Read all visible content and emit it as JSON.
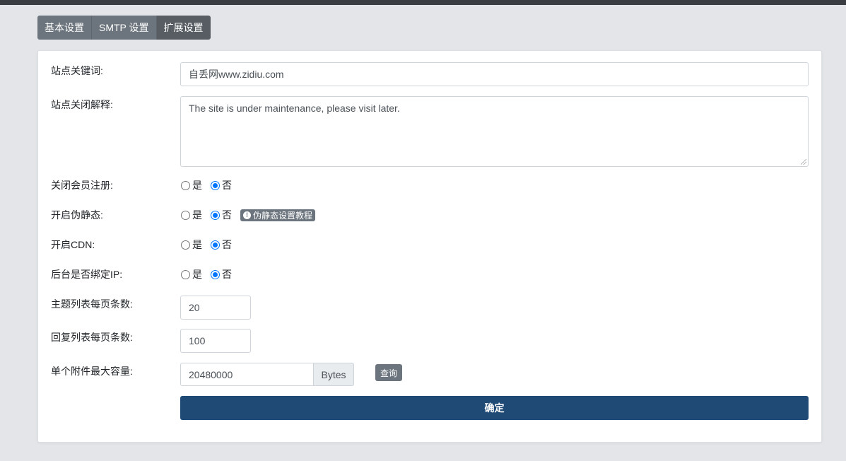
{
  "tabs": [
    {
      "label": "基本设置"
    },
    {
      "label": "SMTP 设置"
    },
    {
      "label": "扩展设置"
    }
  ],
  "form": {
    "keywords": {
      "label": "站点关键词:",
      "value": "自丢网www.zidiu.com"
    },
    "close_reason": {
      "label": "站点关闭解释:",
      "value": "The site is under maintenance, please visit later."
    },
    "close_register": {
      "label": "关闭会员注册:",
      "yes": "是",
      "no": "否",
      "selected": "否"
    },
    "rewrite": {
      "label": "开启伪静态:",
      "yes": "是",
      "no": "否",
      "selected": "否",
      "help_badge": "伪静态设置教程",
      "help_icon": "info-icon"
    },
    "cdn": {
      "label": "开启CDN:",
      "yes": "是",
      "no": "否",
      "selected": "否"
    },
    "bind_ip": {
      "label": "后台是否绑定IP:",
      "yes": "是",
      "no": "否",
      "selected": "否"
    },
    "topics_per_page": {
      "label": "主题列表每页条数:",
      "value": "20"
    },
    "replies_per_page": {
      "label": "回复列表每页条数:",
      "value": "100"
    },
    "max_attachment": {
      "label": "单个附件最大容量:",
      "value": "20480000",
      "unit": "Bytes",
      "query_label": "查询"
    },
    "submit_label": "确定"
  },
  "colors": {
    "accent": "#0075ff",
    "submit": "#1f4a76",
    "tab": "#6c757d",
    "tab_active": "#575d63"
  }
}
